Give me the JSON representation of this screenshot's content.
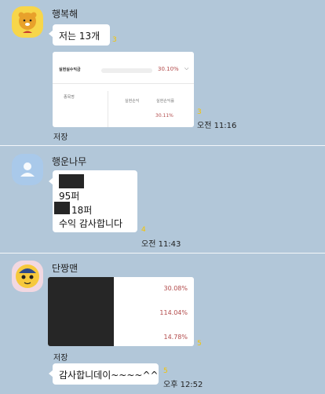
{
  "messages": [
    {
      "sender": "행복해",
      "bubble_text": "저는 13개",
      "bubble_unread": "3",
      "image_card": {
        "title": "실현실수익금",
        "value": "30.10%",
        "col_label": "종목명",
        "col_a": "실현손익",
        "col_b": "실현손익률",
        "row_value": "30.11%"
      },
      "image_unread": "3",
      "time": "오전 11:16",
      "save_label": "저장"
    },
    {
      "sender": "행운나무",
      "lines": [
        "95퍼",
        "18퍼",
        "수익 감사합니다"
      ],
      "unread": "4",
      "time": "오전 11:43"
    },
    {
      "sender": "단짱맨",
      "image_values": [
        "30.08%",
        "114.04%",
        "14.78%"
      ],
      "image_unread": "5",
      "save_label": "저장",
      "bubble_text": "감사합니데이~~~~^^",
      "bubble_unread": "5",
      "time": "오후 12:52"
    }
  ],
  "colors": {
    "background": "#b2c7d9",
    "unread": "#f5c400",
    "percent": "#b24a4a"
  },
  "icons": [
    "ryan-avatar-icon",
    "default-profile-icon",
    "character-avatar-icon",
    "chevron-down-icon"
  ]
}
